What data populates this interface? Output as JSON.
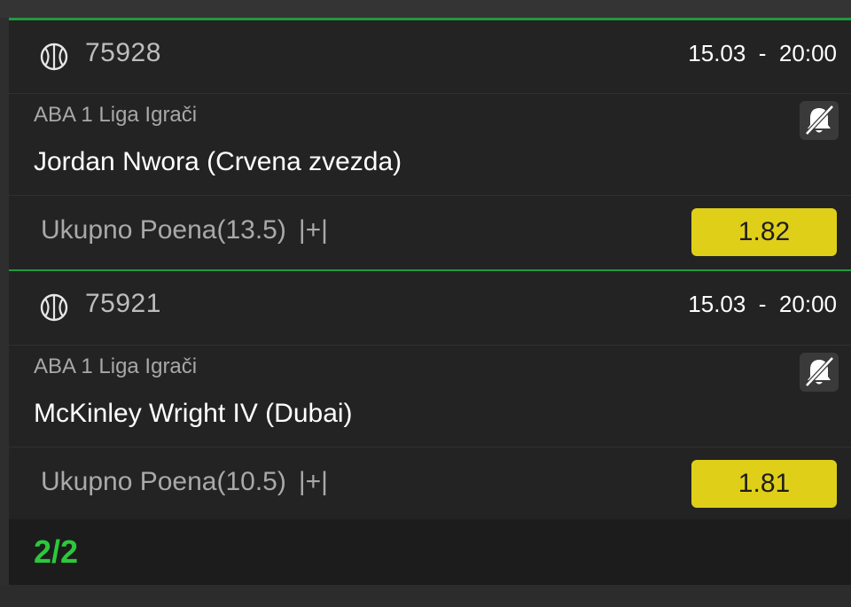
{
  "colors": {
    "accent_green": "#1f9a3d",
    "counter_green": "#2cc83c",
    "odds_yellow": "#e0cf19",
    "card_bg": "#232323"
  },
  "bets": [
    {
      "sport_icon": "basketball-icon",
      "event_code": "75928",
      "date": "15.03",
      "time": "20:00",
      "league": "ABA 1 Liga Igrači",
      "player": "Jordan Nwora (Crvena zvezda)",
      "market": "Ukupno Poena(13.5)",
      "market_flag": "|+|",
      "odds": "1.82",
      "notify_icon": "bell-off-icon"
    },
    {
      "sport_icon": "basketball-icon",
      "event_code": "75921",
      "date": "15.03",
      "time": "20:00",
      "league": "ABA 1 Liga Igrači",
      "player": "McKinley Wright IV (Dubai)",
      "market": "Ukupno Poena(10.5)",
      "market_flag": "|+|",
      "odds": "1.81",
      "notify_icon": "bell-off-icon"
    }
  ],
  "footer": {
    "counter": "2/2"
  }
}
